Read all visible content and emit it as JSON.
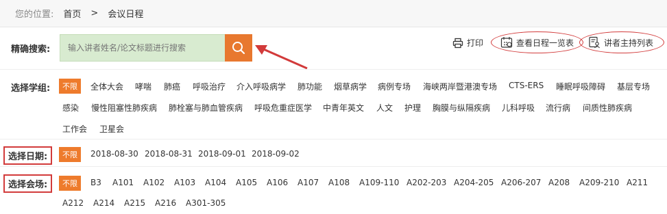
{
  "breadcrumb": {
    "label": "您的位置:",
    "home": "首页",
    "sep": ">",
    "current": "会议日程"
  },
  "search": {
    "label": "精确搜索:",
    "placeholder": "输入讲者姓名/论文标题进行搜索",
    "button_icon": "search-icon"
  },
  "tools": {
    "print": "打印",
    "schedule": "查看日程一览表",
    "speakers": "讲者主持列表"
  },
  "subjects": {
    "label": "选择学组:",
    "items": [
      "不限",
      "全体大会",
      "哮喘",
      "肺癌",
      "呼吸治疗",
      "介入呼吸病学",
      "肺功能",
      "烟草病学",
      "病例专场",
      "海峡两岸暨港澳专场",
      "CTS-ERS",
      "睡眠呼吸障碍",
      "基层专场",
      "感染",
      "慢性阻塞性肺疾病",
      "肺栓塞与肺血管疾病",
      "呼吸危重症医学",
      "中青年英文",
      "人文",
      "护理",
      "胸膜与纵隔疾病",
      "儿科呼吸",
      "流行病",
      "间质性肺疾病",
      "工作会",
      "卫星会"
    ]
  },
  "dates": {
    "label": "选择日期:",
    "items": [
      "不限",
      "2018-08-30",
      "2018-08-31",
      "2018-09-01",
      "2018-09-02"
    ]
  },
  "venues": {
    "label": "选择会场:",
    "items": [
      "不限",
      "B3",
      "A101",
      "A102",
      "A103",
      "A104",
      "A105",
      "A106",
      "A107",
      "A108",
      "A109-110",
      "A202-203",
      "A204-205",
      "A206-207",
      "A208",
      "A209-210",
      "A211",
      "A212",
      "A214",
      "A215",
      "A216",
      "A301-305"
    ]
  },
  "colors": {
    "accent": "#ee7b2c",
    "search_bg": "#d8ebd0",
    "highlight": "#d23a3a"
  }
}
